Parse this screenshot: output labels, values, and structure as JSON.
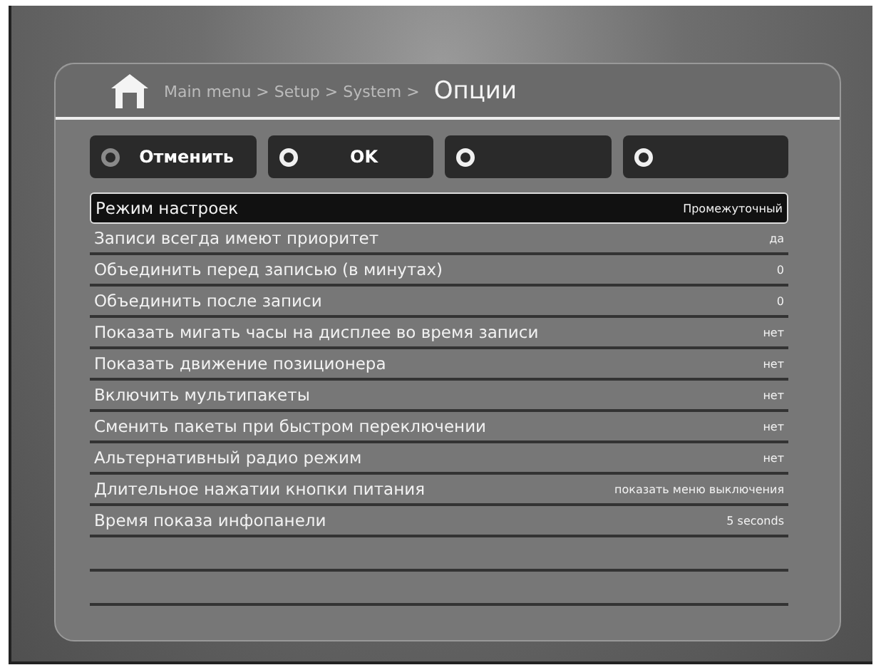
{
  "header": {
    "breadcrumb": "Main menu > Setup > System >",
    "title": "Опции"
  },
  "buttons": [
    {
      "label": "Отменить",
      "dim": true
    },
    {
      "label": "OK",
      "dim": false
    },
    {
      "dim": false
    },
    {
      "dim": false
    }
  ],
  "settings": [
    {
      "label": "Режим настроек",
      "value": "Промежуточный",
      "selected": true
    },
    {
      "label": "Записи всегда имеют приоритет",
      "value": "да",
      "selected": false
    },
    {
      "label": "Объединить перед записью (в минутах)",
      "value": "0",
      "selected": false
    },
    {
      "label": "Объединить после записи",
      "value": "0",
      "selected": false
    },
    {
      "label": "Показать мигать часы на дисплее во время записи",
      "value": "нет",
      "selected": false
    },
    {
      "label": "Показать движение позиционера",
      "value": "нет",
      "selected": false
    },
    {
      "label": "Включить мультипакеты",
      "value": "нет",
      "selected": false
    },
    {
      "label": "Сменить пакеты при быстром переключении",
      "value": "нет",
      "selected": false
    },
    {
      "label": "Альтернативный радио режим",
      "value": "нет",
      "selected": false
    },
    {
      "label": "Длительное нажатии кнопки питания",
      "value": "показать меню выключения",
      "selected": false
    },
    {
      "label": "Время показа инфопанели",
      "value": "5 seconds",
      "selected": false
    }
  ]
}
